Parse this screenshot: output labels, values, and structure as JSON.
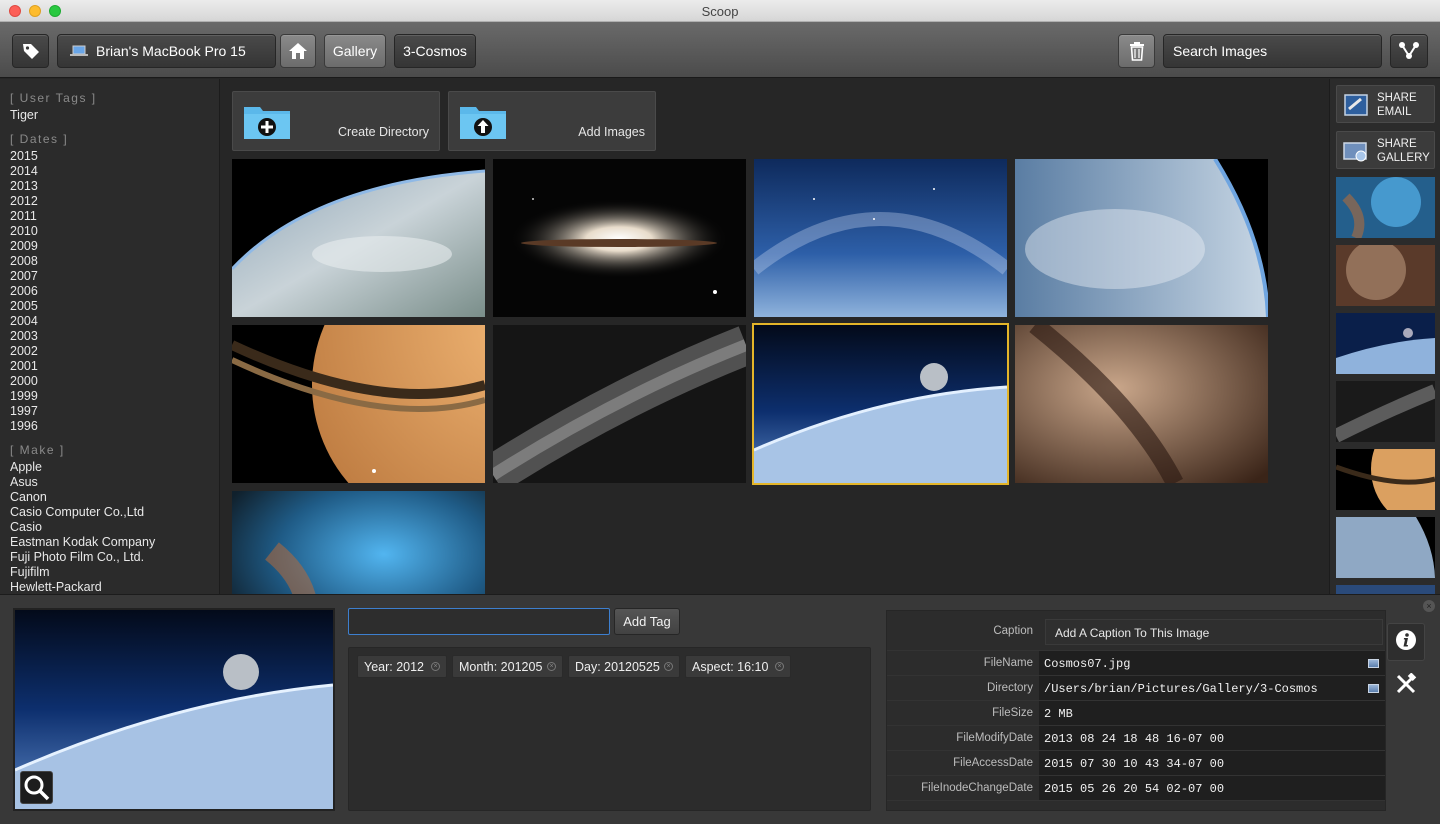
{
  "window": {
    "title": "Scoop"
  },
  "toolbar": {
    "device": "Brian's MacBook Pro 15",
    "breadcrumb": [
      "Gallery",
      "3-Cosmos"
    ],
    "search_label": "Search Images"
  },
  "sidebar": {
    "sections": [
      {
        "title": "[ User Tags ]",
        "items": [
          "Tiger"
        ]
      },
      {
        "title": "[ Dates ]",
        "items": [
          "2015",
          "2014",
          "2013",
          "2012",
          "2011",
          "2010",
          "2009",
          "2008",
          "2007",
          "2006",
          "2005",
          "2004",
          "2003",
          "2002",
          "2001",
          "2000",
          "1999",
          "1997",
          "1996"
        ]
      },
      {
        "title": "[ Make ]",
        "items": [
          "Apple",
          "Asus",
          "Canon",
          "Casio Computer Co.,Ltd",
          "Casio",
          "Eastman Kodak Company",
          "Fuji Photo Film Co., Ltd.",
          "Fujifilm",
          "Hewlett-Packard"
        ]
      }
    ]
  },
  "main": {
    "create_directory": "Create Directory",
    "add_images": "Add Images"
  },
  "share": {
    "email": [
      "SHARE",
      "EMAIL"
    ],
    "gallery": [
      "SHARE",
      "GALLERY"
    ]
  },
  "tags": {
    "input_value": "",
    "add_label": "Add Tag",
    "chips": [
      "Year: 2012",
      "Month: 201205",
      "Day: 20120525",
      "Aspect: 16:10"
    ]
  },
  "metadata": {
    "caption_label": "Caption",
    "caption_value": "Add A Caption To This Image",
    "rows": [
      {
        "key": "FileName",
        "value": "Cosmos07.jpg"
      },
      {
        "key": "Directory",
        "value": "/Users/brian/Pictures/Gallery/3-Cosmos"
      },
      {
        "key": "FileSize",
        "value": "2 MB"
      },
      {
        "key": "FileModifyDate",
        "value": "2013 08 24 18 48 16-07 00"
      },
      {
        "key": "FileAccessDate",
        "value": "2015 07 30 10 43 34-07 00"
      },
      {
        "key": "FileInodeChangeDate",
        "value": "2015 05 26 20 54 02-07 00"
      }
    ]
  },
  "colors": {
    "selection": "#e4b529",
    "accent_blue": "#3d7fcf",
    "folder_blue": "#5bb8ea"
  }
}
